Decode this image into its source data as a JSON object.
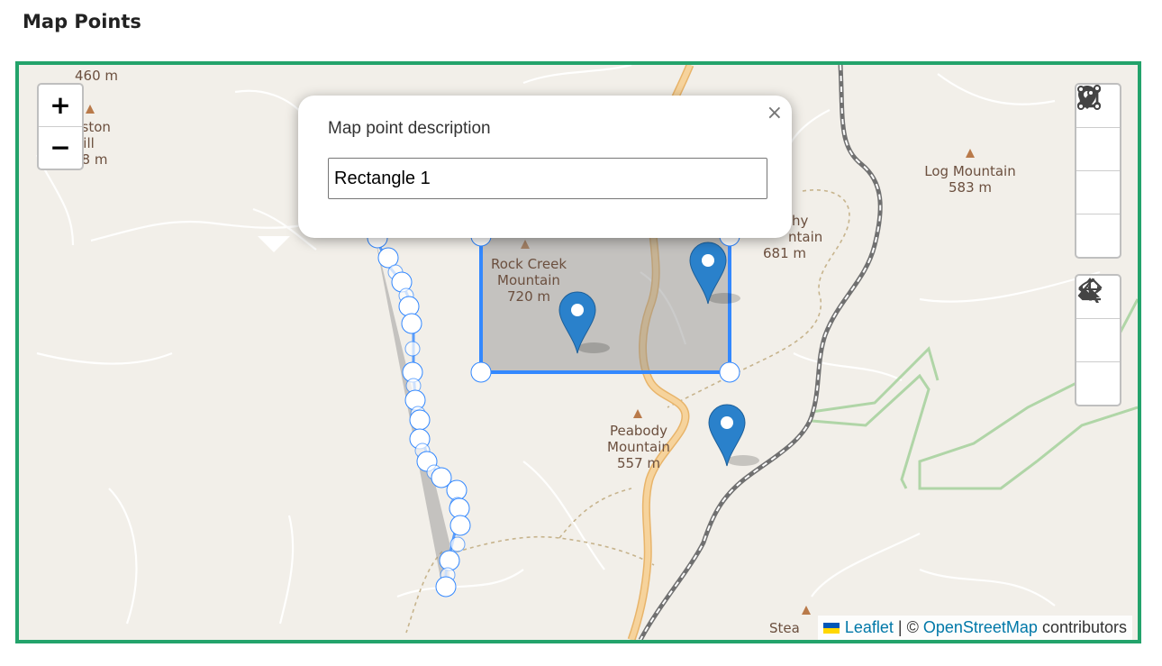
{
  "page": {
    "title": "Map Points"
  },
  "map": {
    "labels": [
      {
        "name": "460 m",
        "elev": ""
      },
      {
        "name": "uston Hill",
        "line2": "Hill",
        "elev": "98 m"
      },
      {
        "name": "Rock Creek",
        "line2": "Mountain",
        "elev": "720 m"
      },
      {
        "name": "Log Mountain",
        "line2": "",
        "elev": "583 m"
      },
      {
        "name": "hy",
        "line2": "ntain",
        "elev": "681 m"
      },
      {
        "name": "Peabody",
        "line2": "Mountain",
        "elev": "557 m"
      },
      {
        "name": "Stea"
      }
    ],
    "zoom": {
      "in": "+",
      "out": "−"
    },
    "draw_toolbar": [
      "marker-icon",
      "polyline-icon",
      "rectangle-icon",
      "polygon-icon"
    ],
    "edit_toolbar": [
      "edit-icon",
      "drag-icon",
      "eraser-icon"
    ],
    "markers": 3,
    "popup": {
      "label": "Map point description",
      "value": "Rectangle 1",
      "close": "×"
    },
    "attribution": {
      "leaflet": "Leaflet",
      "separator": "| ©",
      "osm": "OpenStreetMap",
      "contributors": "contributors",
      "flag_colors": [
        "#0057b7",
        "#ffd700"
      ]
    },
    "colors": {
      "frame": "#23a36b",
      "shape_stroke": "#3388ff",
      "marker": "#2a81cb"
    }
  }
}
